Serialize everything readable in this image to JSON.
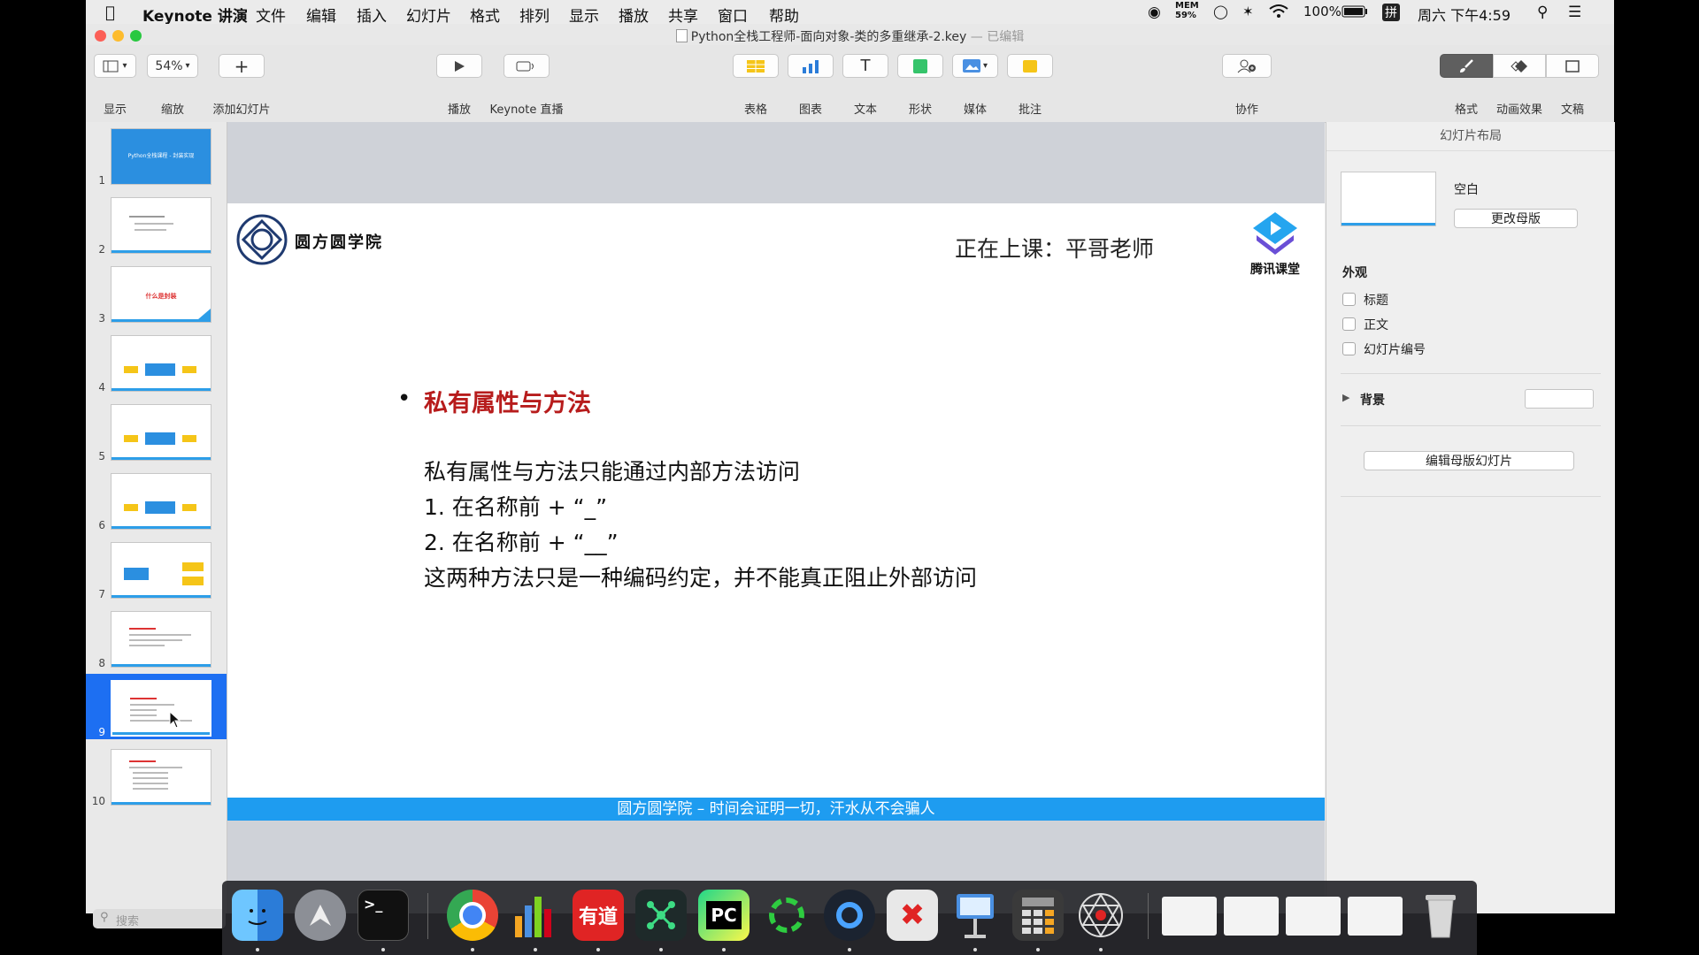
{
  "menubar": {
    "items": [
      "Keynote 讲演",
      "文件",
      "编辑",
      "插入",
      "幻灯片",
      "格式",
      "排列",
      "显示",
      "播放",
      "共享",
      "窗口",
      "帮助"
    ],
    "status": {
      "mem_label": "MEM",
      "mem_value": "59%",
      "battery": "100%",
      "input_method": "拼",
      "clock": "周六 下午4:59"
    }
  },
  "window": {
    "title": "Python全栈工程师-面向对象-类的多重继承-2.key",
    "title_status": "— 已编辑"
  },
  "toolbar": {
    "view": "显示",
    "zoom_value": "54%",
    "zoom": "缩放",
    "add_slide": "添加幻灯片",
    "play": "播放",
    "live": "Keynote 直播",
    "table": "表格",
    "chart": "图表",
    "text": "文本",
    "shape": "形状",
    "media": "媒体",
    "comment": "批注",
    "collaborate": "协作",
    "format": "格式",
    "animate": "动画效果",
    "document": "文稿"
  },
  "navigator": {
    "slides": [
      "1",
      "2",
      "3",
      "4",
      "5",
      "6",
      "7",
      "8",
      "9",
      "10"
    ],
    "selected": "9",
    "slide1_title": "Python全栈课程 - 封装实现",
    "slide3_title": "什么是封装",
    "search_placeholder": "搜索"
  },
  "slide": {
    "school_name": "圆方圆学院",
    "live_now": "正在上课：平哥老师",
    "platform": "腾讯课堂",
    "bullet_title": "私有属性与方法",
    "lines": [
      "私有属性与方法只能通过内部方法访问",
      "1. 在名称前 + “_”",
      "2. 在名称前 + “__”",
      "这两种方法只是一种编码约定，并不能真正阻止外部访问"
    ],
    "footer": "圆方圆学院 – 时间会证明一切，汗水从不会骗人"
  },
  "inspector": {
    "header": "幻灯片布局",
    "layout_name": "空白",
    "change_master": "更改母版",
    "appearance": "外观",
    "option_title": "标题",
    "option_body": "正文",
    "option_number": "幻灯片编号",
    "background": "背景",
    "edit_master": "编辑母版幻灯片"
  },
  "dock": {
    "apps": [
      "finder-icon",
      "launchpad-icon",
      "terminal-icon",
      "chrome-icon",
      "numbers-icon",
      "youdao-icon",
      "xmind-icon",
      "pycharm-icon",
      "activity-icon",
      "quicktime-icon",
      "xmind-zen-icon",
      "keynote-icon",
      "calculator-icon",
      "network-icon"
    ],
    "youdao_label": "有道",
    "pycharm_label": "PC"
  },
  "colors": {
    "accent_blue": "#2196f3",
    "bullet_red": "#b71c1c",
    "footer_blue": "#1e9cf0",
    "selection_blue": "#1d6ff2"
  }
}
